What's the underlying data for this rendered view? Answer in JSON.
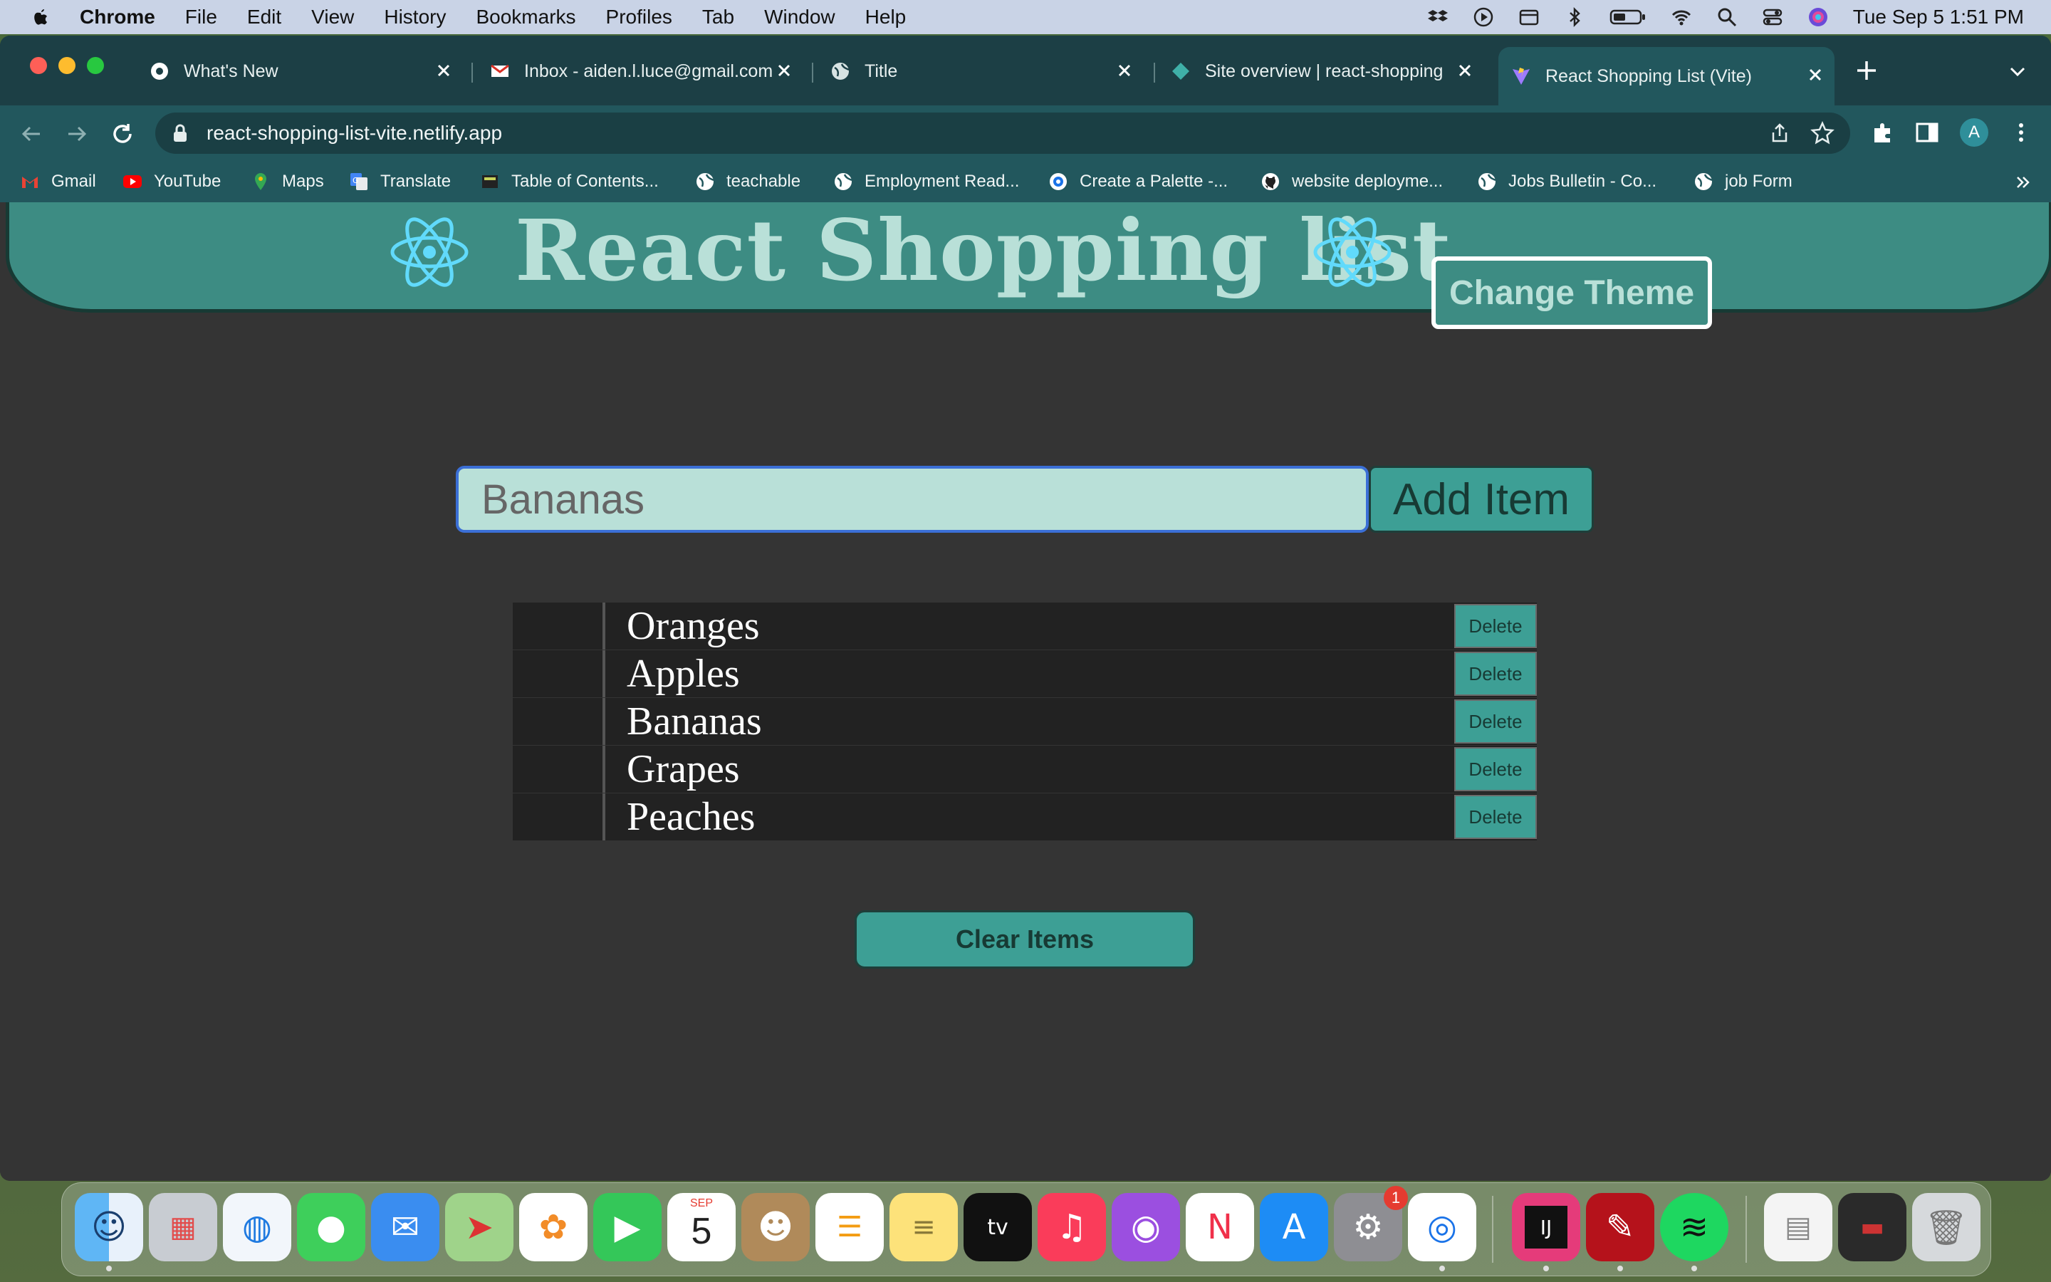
{
  "menubar": {
    "app": "Chrome",
    "items": [
      "File",
      "Edit",
      "View",
      "History",
      "Bookmarks",
      "Profiles",
      "Tab",
      "Window",
      "Help"
    ],
    "clock": "Tue Sep 5  1:51 PM"
  },
  "tabs": [
    {
      "title": "What's New",
      "icon": "chrome-icon"
    },
    {
      "title": "Inbox - aiden.l.luce@gmail.com",
      "icon": "gmail-icon"
    },
    {
      "title": "Title",
      "icon": "globe-icon"
    },
    {
      "title": "Site overview | react-shopping",
      "icon": "netlify-icon"
    },
    {
      "title": "React Shopping List (Vite)",
      "icon": "vite-icon",
      "active": true
    }
  ],
  "omnibox": {
    "url": "react-shopping-list-vite.netlify.app"
  },
  "bookmarks": [
    {
      "label": "Gmail",
      "icon": "gmail-icon"
    },
    {
      "label": "YouTube",
      "icon": "youtube-icon"
    },
    {
      "label": "Maps",
      "icon": "maps-icon"
    },
    {
      "label": "Translate",
      "icon": "translate-icon"
    },
    {
      "label": "Table of Contents...",
      "icon": "book-icon"
    },
    {
      "label": "teachable",
      "icon": "globe-icon"
    },
    {
      "label": "Employment Read...",
      "icon": "globe-icon"
    },
    {
      "label": "Create a Palette -...",
      "icon": "palette-icon"
    },
    {
      "label": "website deployme...",
      "icon": "github-icon"
    },
    {
      "label": "Jobs Bulletin - Co...",
      "icon": "globe-icon"
    },
    {
      "label": "job Form",
      "icon": "globe-icon"
    }
  ],
  "app": {
    "title": "React Shopping list",
    "theme_button": "Change Theme",
    "input_placeholder": "Bananas",
    "add_button": "Add Item",
    "delete_label": "Delete",
    "clear_button": "Clear Items",
    "items": [
      "Oranges",
      "Apples",
      "Bananas",
      "Grapes",
      "Peaches"
    ]
  },
  "colors": {
    "header_bg": "#3d8c83",
    "title_text": "#b9e0d8",
    "button_bg": "#3d9f95",
    "page_bg": "#343434",
    "row_bg": "#222222",
    "tabstrip": "#1c3f45",
    "toolbar": "#22575d"
  },
  "dock": {
    "calendar": {
      "month": "SEP",
      "day": "5"
    },
    "settings_badge": "1",
    "apps": [
      "Finder",
      "Launchpad",
      "Safari",
      "Messages",
      "Mail",
      "Maps",
      "Photos",
      "FaceTime",
      "Calendar",
      "Contacts",
      "Reminders",
      "Notes",
      "TV",
      "Music",
      "Podcasts",
      "News",
      "App Store",
      "System Settings",
      "Chrome",
      "IntelliJ IDEA",
      "Acrobat",
      "Spotify"
    ]
  }
}
